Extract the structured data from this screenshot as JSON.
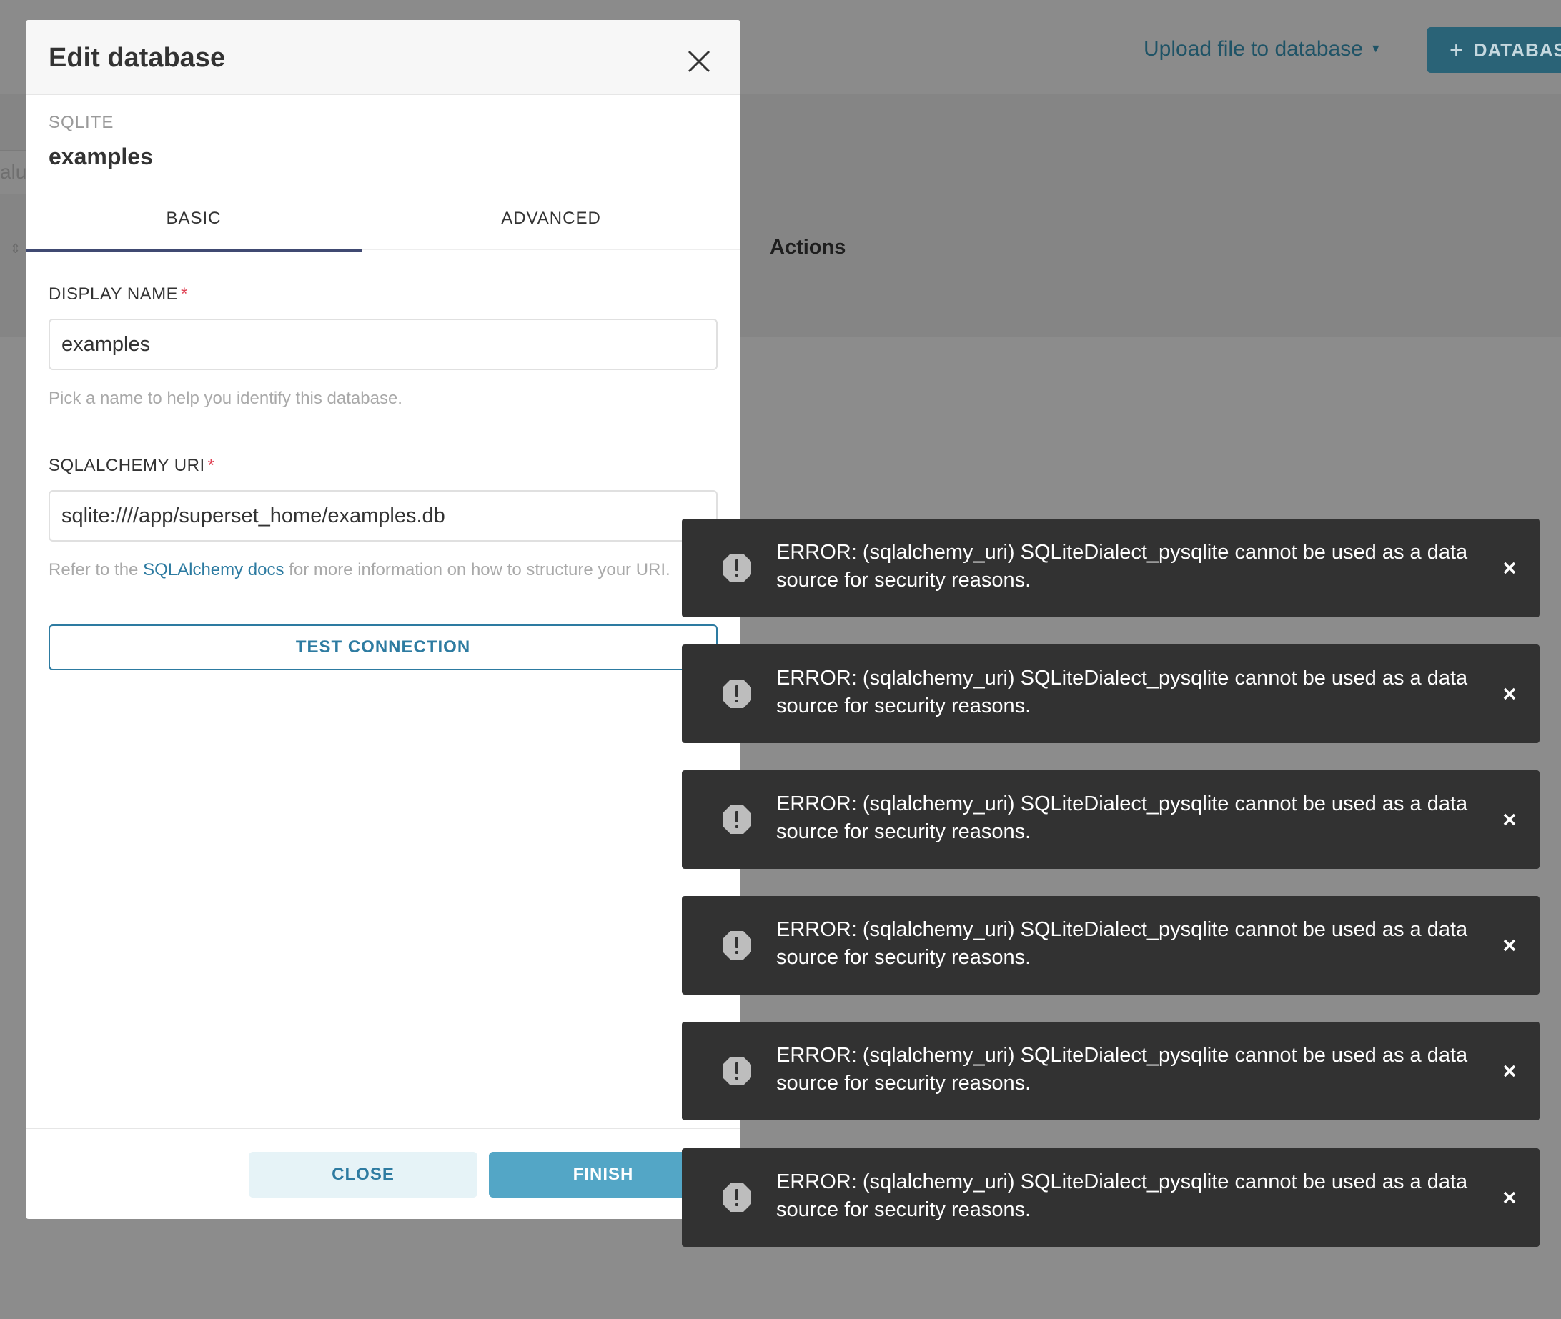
{
  "background": {
    "upload_link": "Upload file to database",
    "add_database_button": "DATABASE",
    "filter_stub": "alu",
    "actions_column": "Actions"
  },
  "modal": {
    "title": "Edit database",
    "db_type": "SQLITE",
    "db_name": "examples",
    "tabs": [
      {
        "label": "BASIC",
        "active": true
      },
      {
        "label": "ADVANCED",
        "active": false
      }
    ],
    "display_name": {
      "label": "DISPLAY NAME",
      "required_mark": "*",
      "value": "examples",
      "helper": "Pick a name to help you identify this database."
    },
    "sqlalchemy_uri": {
      "label": "SQLALCHEMY URI",
      "required_mark": "*",
      "value": "sqlite:////app/superset_home/examples.db",
      "helper_prefix": "Refer to the",
      "helper_link": "SQLAlchemy docs",
      "helper_suffix": "for more information on how to structure your URI."
    },
    "test_connection_button": "TEST CONNECTION",
    "close_button": "CLOSE",
    "finish_button": "FINISH"
  },
  "toasts": [
    {
      "message": "ERROR: (sqlalchemy_uri) SQLiteDialect_pysqlite cannot be used as a data source for security reasons."
    },
    {
      "message": "ERROR: (sqlalchemy_uri) SQLiteDialect_pysqlite cannot be used as a data source for security reasons."
    },
    {
      "message": "ERROR: (sqlalchemy_uri) SQLiteDialect_pysqlite cannot be used as a data source for security reasons."
    },
    {
      "message": "ERROR: (sqlalchemy_uri) SQLiteDialect_pysqlite cannot be used as a data source for security reasons."
    },
    {
      "message": "ERROR: (sqlalchemy_uri) SQLiteDialect_pysqlite cannot be used as a data source for security reasons."
    },
    {
      "message": "ERROR: (sqlalchemy_uri) SQLiteDialect_pysqlite cannot be used as a data source for security reasons."
    }
  ],
  "colors": {
    "overlay": "#8c8c8c",
    "primary": "#2d7ba1",
    "finish": "#53a6c6",
    "toast_bg": "#323232",
    "required": "#e04355",
    "tab_underline": "#404a72"
  },
  "icons": {
    "modal_close": "close-icon",
    "toast_status": "error-octagon-icon",
    "toast_close": "close-icon",
    "add": "plus-icon",
    "dropdown": "caret-down-icon"
  }
}
